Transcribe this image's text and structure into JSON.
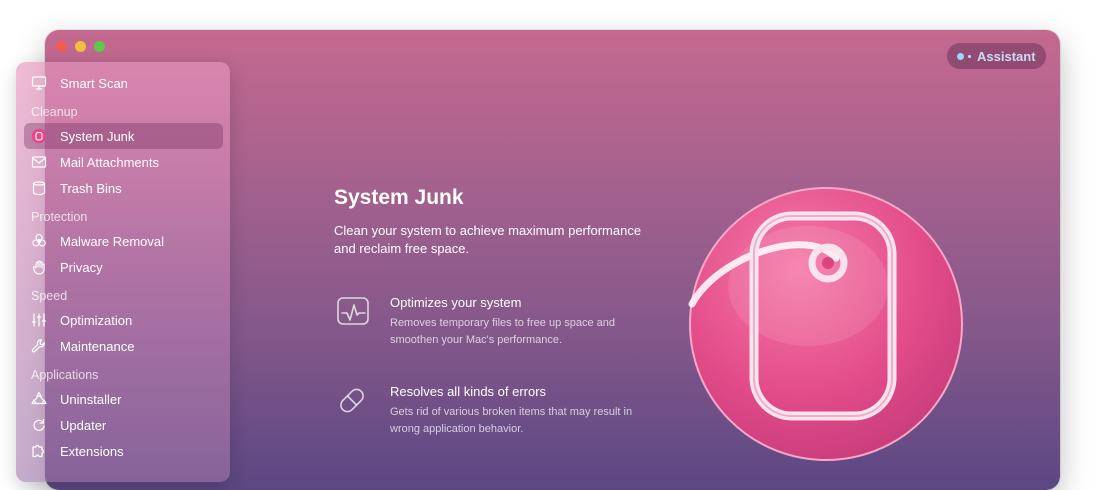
{
  "assistant_label": "Assistant",
  "sidebar": {
    "smart_scan": "Smart Scan",
    "sections": [
      {
        "title": "Cleanup",
        "items": [
          "System Junk",
          "Mail Attachments",
          "Trash Bins"
        ]
      },
      {
        "title": "Protection",
        "items": [
          "Malware Removal",
          "Privacy"
        ]
      },
      {
        "title": "Speed",
        "items": [
          "Optimization",
          "Maintenance"
        ]
      },
      {
        "title": "Applications",
        "items": [
          "Uninstaller",
          "Updater",
          "Extensions"
        ]
      }
    ],
    "active_item": "System Junk"
  },
  "content": {
    "title": "System Junk",
    "description": "Clean your system to achieve maximum performance and reclaim free space.",
    "features": [
      {
        "title": "Optimizes your system",
        "description": "Removes temporary files to free up space and smoothen your Mac's performance.",
        "icon": "activity-monitor-icon"
      },
      {
        "title": "Resolves all kinds of errors",
        "description": "Gets rid of various broken items that may result in wrong application behavior.",
        "icon": "pill-icon"
      }
    ]
  },
  "colors": {
    "window_top": "#c4698f",
    "window_bottom": "#5c4783",
    "hero_pink": "#e8488a",
    "assistant_text": "#c9dcf5"
  }
}
